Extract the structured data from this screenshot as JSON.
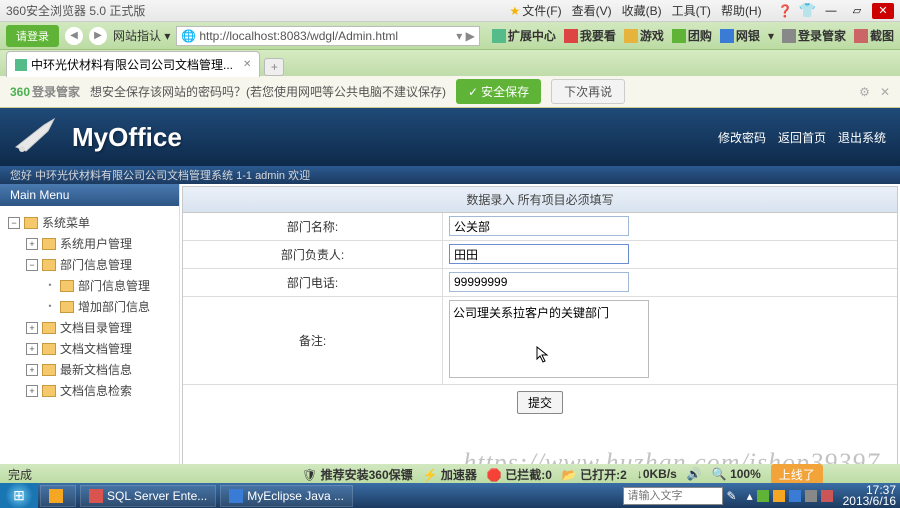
{
  "titlebar": {
    "title": "360安全浏览器 5.0  正式版",
    "menus": [
      "文件(F)",
      "查看(V)",
      "收藏(B)",
      "工具(T)",
      "帮助(H)"
    ]
  },
  "addr": {
    "login_btn": "请登录",
    "label": "网站指认 ▾",
    "url": "http://localhost:8083/wdgl/Admin.html",
    "tools": {
      "ext": "扩展中心",
      "fav": "我要看",
      "game": "游戏",
      "buy": "团购",
      "net": "网银",
      "more": "▾",
      "login": "登录管家",
      "screen": "截图"
    }
  },
  "tab": {
    "label": "中环光伏材料有限公司公司文档管理..."
  },
  "savebar": {
    "logo": "360",
    "logo_sub": "登录管家",
    "msg": "想安全保存该网站的密码吗？(若您使用网吧等公共电脑不建议保存)",
    "save": "安全保存",
    "next": "下次再说"
  },
  "header": {
    "brand": "MyOffice",
    "links": [
      "修改密码",
      "返回首页",
      "退出系统"
    ]
  },
  "welcome": "您好 中环光伏材料有限公司公司文档管理系统  1-1  admin 欢迎",
  "sidebar": {
    "title": "Main Menu",
    "nodes": [
      {
        "lvl": 1,
        "exp": "minus",
        "label": "系统菜单"
      },
      {
        "lvl": 2,
        "exp": "plus",
        "label": "系统用户管理"
      },
      {
        "lvl": 2,
        "exp": "minus",
        "label": "部门信息管理"
      },
      {
        "lvl": 3,
        "exp": "leaf",
        "label": "部门信息管理"
      },
      {
        "lvl": 3,
        "exp": "leaf",
        "label": "增加部门信息"
      },
      {
        "lvl": 2,
        "exp": "plus",
        "label": "文档目录管理"
      },
      {
        "lvl": 2,
        "exp": "plus",
        "label": "文档文档管理"
      },
      {
        "lvl": 2,
        "exp": "plus",
        "label": "最新文档信息"
      },
      {
        "lvl": 2,
        "exp": "plus",
        "label": "文档信息检索"
      }
    ]
  },
  "form": {
    "caption": "数据录入  所有项目必须填写",
    "rows": {
      "dept_name": {
        "label": "部门名称:",
        "value": "公关部"
      },
      "manager": {
        "label": "部门负责人:",
        "value": "田田"
      },
      "phone": {
        "label": "部门电话:",
        "value": "99999999"
      },
      "remark": {
        "label": "备注:",
        "value": "公司理关系拉客户的关键部门"
      }
    },
    "submit": "提交"
  },
  "watermark": "https://www.huzhan.com/ishop39397",
  "status": {
    "done": "完成",
    "items": {
      "guard": "推荐安装360保镖",
      "accel": "加速器",
      "block": "已拦截:0",
      "open": "已打开:2",
      "down": "↓0KB/s",
      "zoom": "100%",
      "dl": "上线了"
    }
  },
  "taskbar": {
    "items": [
      "",
      "SQL Server Ente...",
      "MyEclipse Java ..."
    ],
    "input_placeholder": "请输入文字",
    "clock": {
      "time": "17:37",
      "date": "2013/6/16"
    }
  }
}
